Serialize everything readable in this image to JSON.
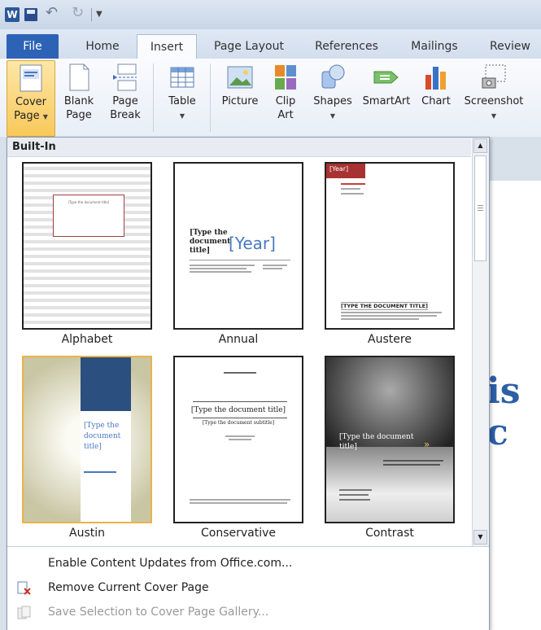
{
  "tabs": [
    "File",
    "Home",
    "Insert",
    "Page Layout",
    "References",
    "Mailings",
    "Review"
  ],
  "active_tab": "Insert",
  "ribbon": [
    {
      "line1": "Cover",
      "line2": "Page",
      "dropdown": true,
      "icon": "cover-page-icon"
    },
    {
      "line1": "Blank",
      "line2": "Page",
      "dropdown": false,
      "icon": "blank-page-icon"
    },
    {
      "line1": "Page",
      "line2": "Break",
      "dropdown": false,
      "icon": "page-break-icon"
    },
    {
      "line1": "Table",
      "line2": "",
      "dropdown": true,
      "icon": "table-icon"
    },
    {
      "line1": "Picture",
      "line2": "",
      "dropdown": false,
      "icon": "picture-icon"
    },
    {
      "line1": "Clip",
      "line2": "Art",
      "dropdown": false,
      "icon": "clip-art-icon"
    },
    {
      "line1": "Shapes",
      "line2": "",
      "dropdown": true,
      "icon": "shapes-icon"
    },
    {
      "line1": "SmartArt",
      "line2": "",
      "dropdown": false,
      "icon": "smartart-icon"
    },
    {
      "line1": "Chart",
      "line2": "",
      "dropdown": false,
      "icon": "chart-icon"
    },
    {
      "line1": "Screenshot",
      "line2": "",
      "dropdown": true,
      "icon": "screenshot-icon"
    }
  ],
  "gallery": {
    "section": "Built-In",
    "items": [
      {
        "name": "Alphabet"
      },
      {
        "name": "Annual"
      },
      {
        "name": "Austere"
      },
      {
        "name": "Austin"
      },
      {
        "name": "Conservative"
      },
      {
        "name": "Contrast"
      }
    ],
    "thumb_text": {
      "alphabet_title": "[Type the document title]",
      "annual_title": "[Type the document title]",
      "annual_year": "[Year]",
      "austere_year": "[Year]",
      "austere_title": "[TYPE THE DOCUMENT TITLE]",
      "austin_title": "[Type the document title]",
      "conservative_title": "[Type the document title]",
      "conservative_subtitle": "[Type the document subtitle]",
      "contrast_title": "[Type the document title]"
    },
    "commands": [
      {
        "label": "Enable Content Updates from Office.com...",
        "enabled": true
      },
      {
        "label": "Remove Current Cover Page",
        "enabled": true
      },
      {
        "label": "Save Selection to Cover Page Gallery...",
        "enabled": false
      }
    ]
  },
  "doc_partial_text": "is c"
}
